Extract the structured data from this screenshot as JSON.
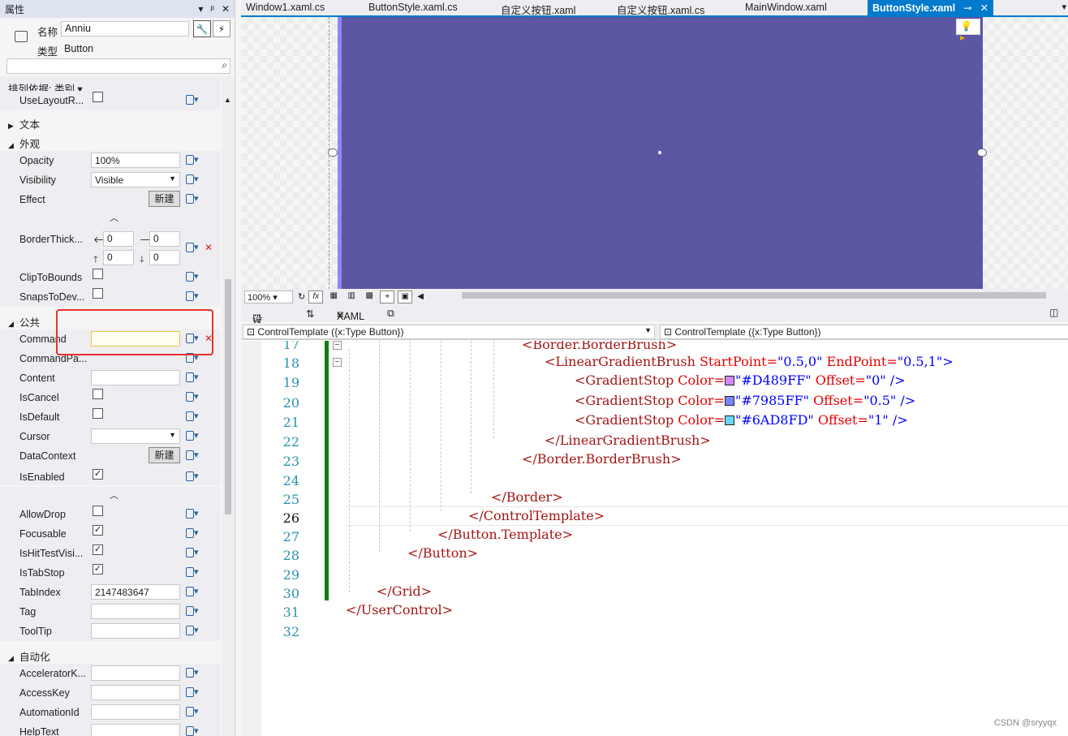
{
  "props": {
    "title": "属性",
    "title_icons": [
      "▾",
      "ᵖ",
      "✕"
    ],
    "name_label": "名称",
    "name_value": "Anniu",
    "type_label": "类型",
    "type_value": "Button",
    "sort_label": "排列依据: 类别 ▾",
    "new_label": "新建",
    "rows": {
      "uselayout": "UseLayoutR...",
      "cat_text": "文本",
      "cat_appearance": "外观",
      "opacity": "Opacity",
      "opacity_val": "100%",
      "visibility": "Visibility",
      "visibility_val": "Visible",
      "effect": "Effect",
      "borderthick": "BorderThick...",
      "bt_left": "0",
      "bt_right": "0",
      "bt_top": "0",
      "bt_bottom": "0",
      "cliptobounds": "ClipToBounds",
      "snapstodev": "SnapsToDev...",
      "cat_common": "公共",
      "command": "Command",
      "commandpa": "CommandPa...",
      "content": "Content",
      "iscancel": "IsCancel",
      "isdefault": "IsDefault",
      "cursor": "Cursor",
      "datacontext": "DataContext",
      "isenabled": "IsEnabled",
      "allowdrop": "AllowDrop",
      "focusable": "Focusable",
      "ishittest": "IsHitTestVisi...",
      "istabstop": "IsTabStop",
      "tabindex": "TabIndex",
      "tabindex_val": "2147483647",
      "tag": "Tag",
      "tooltip": "ToolTip",
      "cat_automation": "自动化",
      "accelerator": "AcceleratorK...",
      "accesskey": "AccessKey",
      "automationid": "AutomationId",
      "helptext": "HelpText"
    }
  },
  "editor": {
    "tabs": [
      "Window1.xaml.cs",
      "ButtonStyle.xaml.cs",
      "自定义按钮.xaml",
      "自定义按钮.xaml.cs",
      "MainWindow.xaml",
      "ButtonStyle.xaml"
    ],
    "zoom": "100%",
    "fx": "fx",
    "design_tab": "设计",
    "swap": "⇅",
    "xaml_tab": "XAML",
    "combo_left": "ControlTemplate ({x:Type Button})",
    "combo_right": "ControlTemplate ({x:Type Button})",
    "line_numbers": [
      "17",
      "18",
      "19",
      "20",
      "21",
      "22",
      "23",
      "24",
      "25",
      "26",
      "27",
      "28",
      "29",
      "30",
      "31",
      "32"
    ],
    "code": {
      "l17": "<Border.BorderBrush>",
      "l18_tag": "<LinearGradientBrush",
      "l18_a1": " StartPoint=",
      "l18_v1": "\"0.5,0\"",
      "l18_a2": " EndPoint=",
      "l18_v2": "\"0.5,1\"",
      "l18_end": ">",
      "l19_tag": "<GradientStop",
      "l19_a1": " Color=",
      "l19_v1": "\"#D489FF\"",
      "l19_a2": " Offset=",
      "l19_v2": "\"0\"",
      "l19_end": " />",
      "l20_v1": "\"#7985FF\"",
      "l20_v2": "\"0.5\"",
      "l21_v1": "\"#6AD8FD\"",
      "l21_v2": "\"1\"",
      "l22": "</LinearGradientBrush>",
      "l23": "</Border.BorderBrush>",
      "l25": "</Border>",
      "l26": "</ControlTemplate>",
      "l27": "</Button.Template>",
      "l28": "</Button>",
      "l30": "</Grid>",
      "l31": "</UserControl>"
    },
    "swatch_colors": [
      "#D489FF",
      "#7985FF",
      "#6AD8FD"
    ]
  },
  "colors": {
    "button_fill": "#5b57a2",
    "accent": "#007acc",
    "highlight_box": "#e8332a"
  },
  "watermark": "CSDN @sryyqx"
}
